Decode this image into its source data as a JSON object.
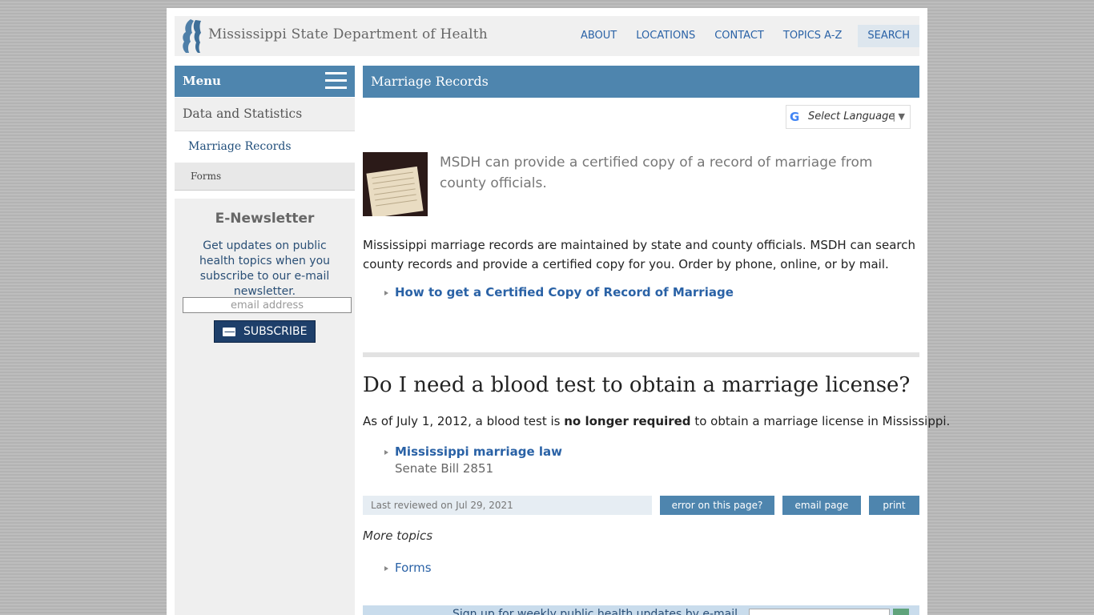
{
  "header": {
    "site_name": "Mississippi State Department of Health",
    "nav": [
      "ABOUT",
      "LOCATIONS",
      "CONTACT",
      "TOPICS A-Z",
      "SEARCH"
    ]
  },
  "sidebar": {
    "menu_label": "Menu",
    "section": "Data and Statistics",
    "current": "Marriage Records",
    "sub": "Forms"
  },
  "newsletter": {
    "title": "E-Newsletter",
    "text": "Get updates on public health topics when you subscribe to our e-mail newsletter.",
    "placeholder": "email address",
    "button": "SUBSCRIBE"
  },
  "main": {
    "title": "Marriage Records",
    "translate": "Select Language",
    "lead": "MSDH can provide a certified copy of a record of marriage from county officials.",
    "body": "Mississippi marriage records are maintained by state and county officials. MSDH can search county records and provide a certified copy for you. Order by phone, online, or by mail.",
    "link1": "How to get a Certified Copy of Record of Marriage",
    "h2": "Do I need a blood test to obtain a marriage license?",
    "body2_pre": "As of July 1, 2012, a blood test is ",
    "body2_bold": "no longer required",
    "body2_post": " to obtain a marriage license in Mississippi.",
    "link2": "Mississippi marriage law",
    "link2_sub": "Senate Bill 2851",
    "reviewed": "Last reviewed on Jul 29, 2021",
    "actions": [
      "error on this page?",
      "email page",
      "print"
    ],
    "more_topics": "More topics",
    "more_link": "Forms",
    "signup_text": "Sign up for weekly public health updates by e-mail"
  },
  "colors": {
    "accent": "#4e85ae",
    "link": "#2a62a6",
    "button": "#1e3f6a"
  }
}
